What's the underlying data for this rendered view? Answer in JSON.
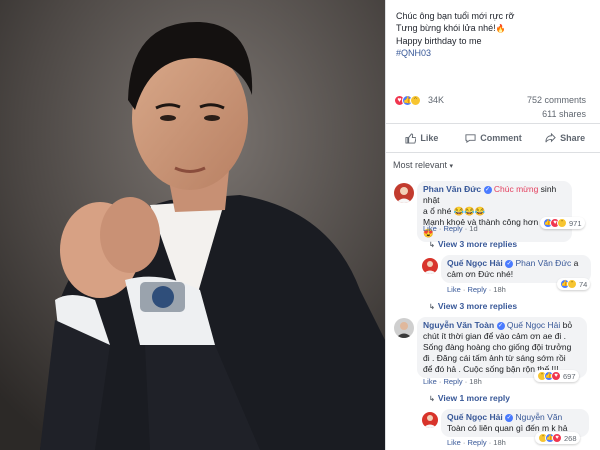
{
  "post": {
    "caption_line1": "Chúc ông bạn tuổi mới rực rỡ",
    "caption_line2": "Tưng bừng khói lửa nhé!",
    "caption_line3": "Happy birthday to me",
    "hashtag": "#QNH03",
    "reactions_count": "34K",
    "comments_count": "752 comments",
    "shares_count": "611 shares"
  },
  "actions": {
    "like": "Like",
    "comment": "Comment",
    "share": "Share"
  },
  "sort": {
    "label": "Most relevant"
  },
  "comments": [
    {
      "author": "Phan Văn Đức",
      "text_highlight": "Chúc mừng",
      "text_line1": " sinh nhật",
      "text_line2": "a ổ nhé",
      "text_line3": "Mạnh khoẻ và thành công hơn a nhé",
      "like": "Like",
      "reply": "Reply",
      "time": "1d",
      "reactions": "971",
      "view_more": "View 3 more replies"
    },
    {
      "author": "Quế Ngọc Hải",
      "tag": "Phan Văn Đức",
      "text_line1": " a",
      "text_line2": "cảm ơn Đức nhé!",
      "like": "Like",
      "reply": "Reply",
      "time": "18h",
      "reactions": "74",
      "view_more": "View 3 more replies"
    },
    {
      "author": "Nguyễn Văn Toàn",
      "tag": "Quế Ngọc Hải",
      "text_line1": " bỏ",
      "text_line2": "chút ít thời gian để vào cảm ơn ae đi .",
      "text_line3": "Sống đàng hoàng cho giống đội trưởng",
      "text_line4": "đi . Đăng cái tấm ảnh từ sáng sớm rồi",
      "text_line5": "để đó hả . Cuộc sống bận rộn thế !!!",
      "like": "Like",
      "reply": "Reply",
      "time": "18h",
      "reactions": "697",
      "view_more": "View 1 more reply"
    },
    {
      "author": "Quế Ngọc Hải",
      "tag": "Nguyễn Văn",
      "text_line2": "Toàn có liên quan gì đến m k hả",
      "like": "Like",
      "reply": "Reply",
      "time": "18h",
      "reactions": "268"
    }
  ]
}
